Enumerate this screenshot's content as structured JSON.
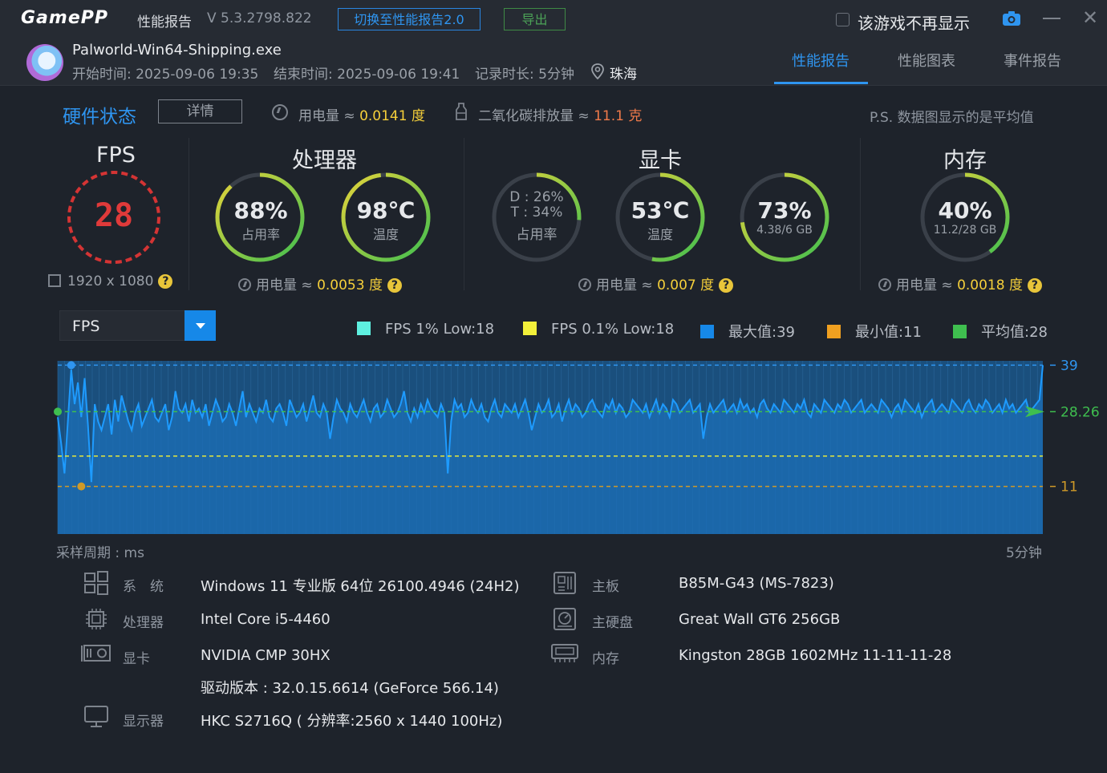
{
  "titlebar": {
    "logo": "GamePP",
    "app_name": "性能报告",
    "version": "V 5.3.2798.822",
    "switch_button": "切换至性能报告2.0",
    "export_button": "导出",
    "hide_game_label": "该游戏不再显示"
  },
  "session": {
    "exe": "Palworld-Win64-Shipping.exe",
    "start": "开始时间: 2025-09-06 19:35",
    "end": "结束时间: 2025-09-06 19:41",
    "duration": "记录时长: 5分钟",
    "location": "珠海"
  },
  "tabs": [
    {
      "label": "性能报告",
      "active": true
    },
    {
      "label": "性能图表",
      "active": false
    },
    {
      "label": "事件报告",
      "active": false
    }
  ],
  "hardware": {
    "title": "硬件状态",
    "detail_button": "详情",
    "power_label": "用电量 ≈ ",
    "power_value": "0.0141 度",
    "co2_label": "二氧化碳排放量 ≈ ",
    "co2_value": "11.1 克",
    "note": "P.S. 数据图显示的是平均值"
  },
  "sections": {
    "fps": {
      "title": "FPS",
      "value": "28",
      "resolution": "1920 x 1080"
    },
    "cpu": {
      "title": "处理器",
      "usage_value": "88%",
      "usage_label": "占用率",
      "usage_fraction": 0.88,
      "temp_value": "98℃",
      "temp_label": "温度",
      "temp_fraction": 0.98,
      "power_label": "用电量 ≈ ",
      "power_value": "0.0053 度"
    },
    "gpu": {
      "title": "显卡",
      "usage_d": "D : 26%",
      "usage_t": "T : 34%",
      "usage_label": "占用率",
      "usage_fraction": 0.26,
      "temp_value": "53℃",
      "temp_label": "温度",
      "temp_fraction": 0.53,
      "mem_value": "73%",
      "mem_sub": "4.38/6 GB",
      "mem_fraction": 0.73,
      "power_label": "用电量 ≈ ",
      "power_value": "0.007 度"
    },
    "memory": {
      "title": "内存",
      "value": "40%",
      "sub": "11.2/28 GB",
      "fraction": 0.4,
      "power_label": "用电量 ≈ ",
      "power_value": "0.0018 度"
    }
  },
  "chart_controls": {
    "selected_metric": "FPS",
    "legend": [
      {
        "label": "FPS 1% Low:18",
        "color": "#5ef0e0"
      },
      {
        "label": "FPS 0.1% Low:18",
        "color": "#f2f03a"
      },
      {
        "label": "最大值:39",
        "color": "#1688e8"
      },
      {
        "label": "最小值:11",
        "color": "#f0a020"
      },
      {
        "label": "平均值:28",
        "color": "#3fbf4f"
      }
    ],
    "sample_label": "采样周期 : ms",
    "duration_label": "5分钟"
  },
  "chart_data": {
    "type": "area",
    "title": "",
    "xlabel": "采样周期 : ms",
    "ylabel": "",
    "ylim": [
      0,
      40
    ],
    "max": 39,
    "min": 11,
    "avg": 28.26,
    "low_1pct": 18,
    "right_labels": [
      "39",
      "28.26",
      "11"
    ],
    "series": [
      {
        "values": [
          27,
          21,
          14,
          26,
          38,
          30,
          35,
          27,
          36,
          25,
          12,
          30,
          26,
          24,
          27,
          30,
          23,
          31,
          26,
          32,
          29,
          26,
          24,
          28,
          30,
          25,
          27,
          29,
          31,
          27,
          26,
          28,
          30,
          24,
          27,
          33,
          29,
          28,
          30,
          26,
          31,
          28,
          29,
          27,
          30,
          25,
          28,
          31,
          29,
          26,
          27,
          30,
          28,
          25,
          29,
          33,
          27,
          30,
          28,
          26,
          29,
          28,
          31,
          27,
          26,
          29,
          30,
          28,
          25,
          31,
          29,
          27,
          28,
          30,
          26,
          29,
          32,
          28,
          27,
          30,
          28,
          22,
          27,
          31,
          29,
          28,
          26,
          30,
          28,
          27,
          29,
          31,
          28,
          26,
          29,
          30,
          27,
          28,
          31,
          29,
          27,
          28,
          30,
          33,
          28,
          26,
          29,
          27,
          30,
          28,
          31,
          29,
          28,
          27,
          30,
          28,
          14,
          26,
          31,
          29,
          30,
          27,
          28,
          31,
          29,
          28,
          30,
          27,
          26,
          29,
          31,
          28,
          27,
          30,
          29,
          28,
          30,
          27,
          29,
          31,
          28,
          24,
          27,
          30,
          28,
          29,
          31,
          27,
          28,
          30,
          26,
          29,
          31,
          28,
          30,
          29,
          27,
          28,
          30,
          31,
          29,
          28,
          27,
          30,
          29,
          31,
          28,
          30,
          29,
          27,
          28,
          31,
          30,
          29,
          28,
          30,
          27,
          29,
          31,
          28,
          30,
          29,
          27,
          31,
          30,
          28,
          29,
          30,
          31,
          28,
          29,
          30,
          22,
          27,
          30,
          28,
          29,
          30,
          31,
          28,
          29,
          30,
          28,
          31,
          29,
          30,
          28,
          29,
          27,
          30,
          31,
          29,
          28,
          30,
          29,
          28,
          31,
          30,
          29,
          28,
          30,
          29,
          31,
          28,
          27,
          30,
          29,
          28,
          31,
          30,
          29,
          28,
          30,
          29,
          31,
          30,
          28,
          29,
          30,
          31,
          28,
          29,
          30,
          29,
          28,
          31,
          30,
          29,
          27,
          29,
          30,
          28,
          31,
          30,
          29,
          28,
          30,
          27,
          29,
          30,
          31,
          28,
          29,
          30,
          29,
          28,
          31,
          30,
          29,
          28,
          30,
          31,
          29,
          28,
          30,
          29,
          31,
          30,
          28,
          29,
          30,
          28,
          31,
          29,
          30,
          28,
          29,
          30,
          31,
          28,
          29,
          30,
          31,
          39
        ]
      }
    ]
  },
  "system_info": {
    "os_key": "系　统",
    "os_val": "Windows 11 专业版 64位 26100.4946 (24H2)",
    "cpu_key": "处理器",
    "cpu_val": "Intel Core i5-4460",
    "gpu_key": "显卡",
    "gpu_val": "NVIDIA CMP 30HX",
    "driver_val": "驱动版本 : 32.0.15.6614 (GeForce 566.14)",
    "monitor_key": "显示器",
    "monitor_val": "HKC S2716Q ( 分辨率:2560 x 1440 100Hz)",
    "mb_key": "主板",
    "mb_val": "B85M-G43 (MS-7823)",
    "disk_key": "主硬盘",
    "disk_val": "Great Wall GT6 256GB",
    "ram_key": "内存",
    "ram_val": "Kingston 28GB 1602MHz 11-11-11-28"
  }
}
